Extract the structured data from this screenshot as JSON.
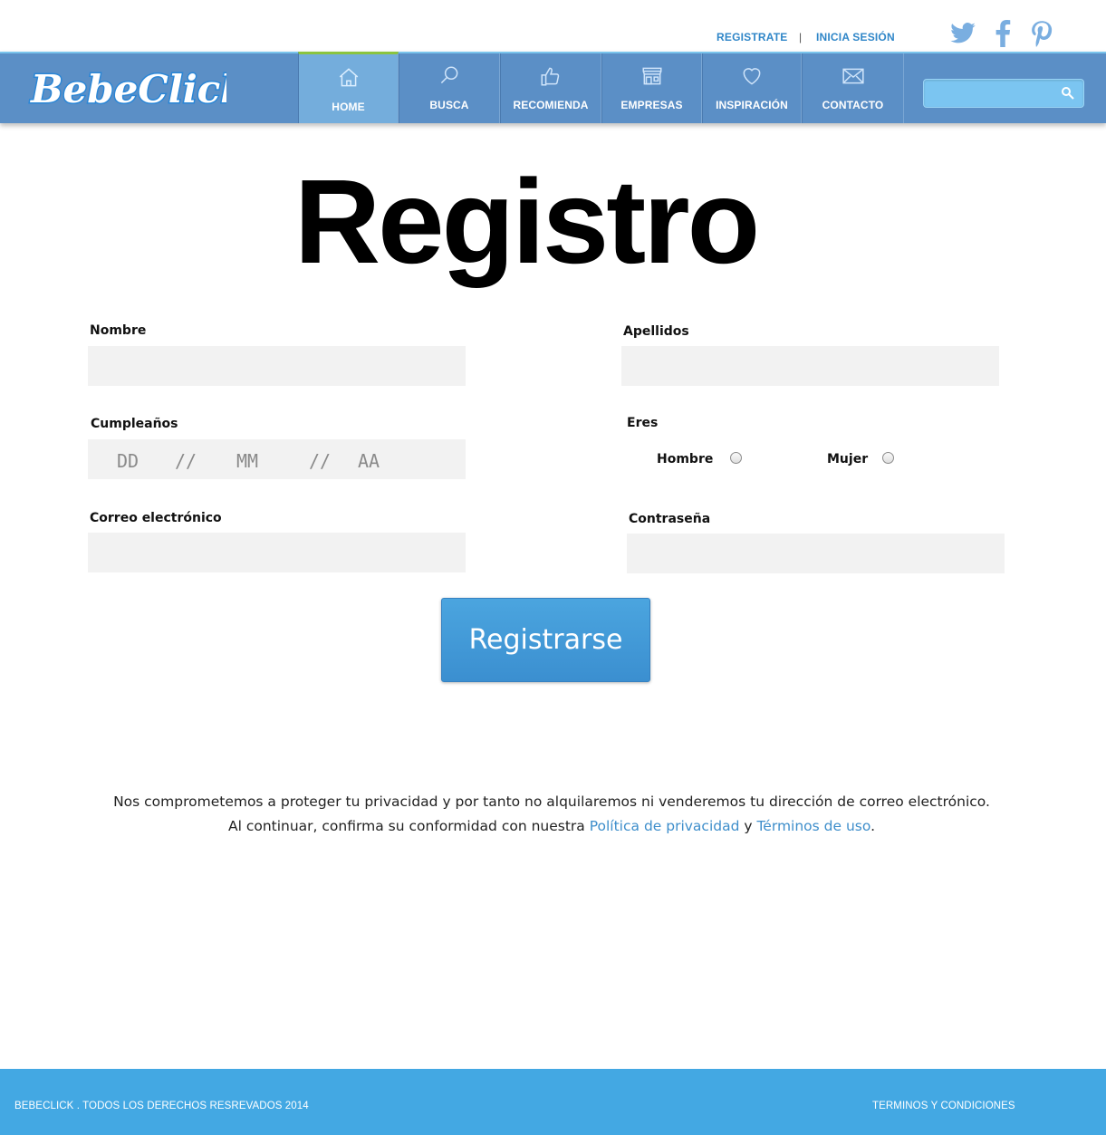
{
  "top": {
    "register_link": "REGISTRATE",
    "separator": "|",
    "login_link": "INICIA SESIÓN",
    "social": [
      "twitter-icon",
      "facebook-icon",
      "pinterest-icon"
    ]
  },
  "nav": {
    "brand": "BebeClick",
    "items": [
      {
        "label": "HOME",
        "icon": "home-icon",
        "active": true
      },
      {
        "label": "BUSCA",
        "icon": "search-icon",
        "active": false
      },
      {
        "label": "RECOMIENDA",
        "icon": "thumbs-up-icon",
        "active": false
      },
      {
        "label": "EMPRESAS",
        "icon": "store-icon",
        "active": false
      },
      {
        "label": "INSPIRACIÓN",
        "icon": "heart-icon",
        "active": false
      },
      {
        "label": "CONTACTO",
        "icon": "envelope-icon",
        "active": false
      }
    ],
    "search_value": ""
  },
  "page": {
    "title": "Registro"
  },
  "form": {
    "nombre_label": "Nombre",
    "apellidos_label": "Apellidos",
    "cumple_label": "Cumpleaños",
    "date": {
      "dd": "DD",
      "sep1": "//",
      "mm": "MM",
      "sep2": "//",
      "aa": "AA"
    },
    "eres_label": "Eres",
    "hombre_label": "Hombre",
    "mujer_label": "Mujer",
    "email_label": "Correo electrónico",
    "password_label": "Contraseña",
    "submit_label": "Registrarse"
  },
  "privacy": {
    "line1": "Nos comprometemos a proteger tu privacidad y por tanto no alquilaremos ni venderemos tu dirección de correo electrónico.",
    "line2_prefix": "Al continuar, confirma su conformidad con nuestra ",
    "policy_link": "Política de privacidad",
    "conj": " y ",
    "terms_link": "Términos de uso",
    "period": "."
  },
  "footer": {
    "copyright": "BEBECLICK . TODOS LOS DERECHOS RESREVADOS 2014",
    "terms": "TERMINOS Y CONDICIONES"
  },
  "colors": {
    "nav_bg": "#5b8fc6",
    "nav_active": "#74addc",
    "accent": "#2f86c8",
    "footer_bg": "#43a8e3",
    "button": "#4399d8"
  }
}
